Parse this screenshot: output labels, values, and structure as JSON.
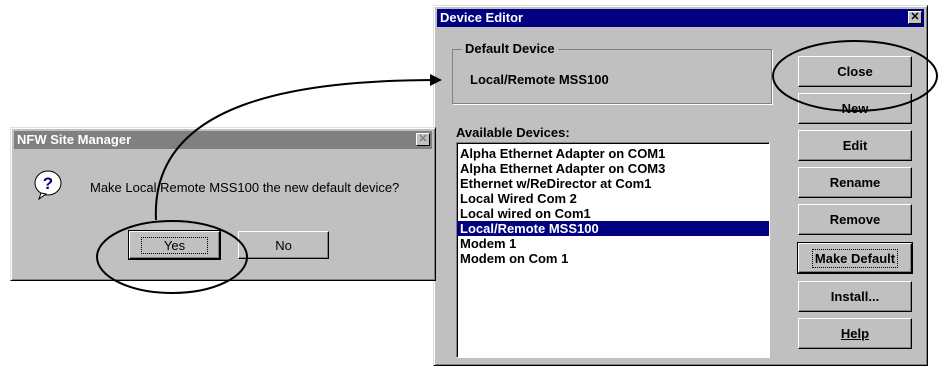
{
  "device_editor": {
    "title": "Device Editor",
    "close_glyph": "✕",
    "default_device_legend": "Default Device",
    "default_device_value": "Local/Remote MSS100",
    "available_label": "Available Devices:",
    "devices": [
      "Alpha Ethernet Adapter on COM1",
      "Alpha Ethernet Adapter on COM3",
      "Ethernet w/ReDirector at Com1",
      "Local Wired Com 2",
      "Local wired on Com1",
      "Local/Remote MSS100",
      "Modem 1",
      "Modem on Com 1"
    ],
    "selected_device": "Local/Remote MSS100",
    "buttons": {
      "close": "Close",
      "new": "New",
      "edit": "Edit",
      "rename": "Rename",
      "remove": "Remove",
      "make_default": "Make Default",
      "install": "Install...",
      "help": "Help"
    }
  },
  "site_manager": {
    "title": "NFW Site Manager",
    "close_glyph": "✕",
    "icon": "question-icon",
    "icon_glyph": "?",
    "message": "Make Local/Remote MSS100 the new default device?",
    "yes_label": "Yes",
    "no_label": "No"
  }
}
